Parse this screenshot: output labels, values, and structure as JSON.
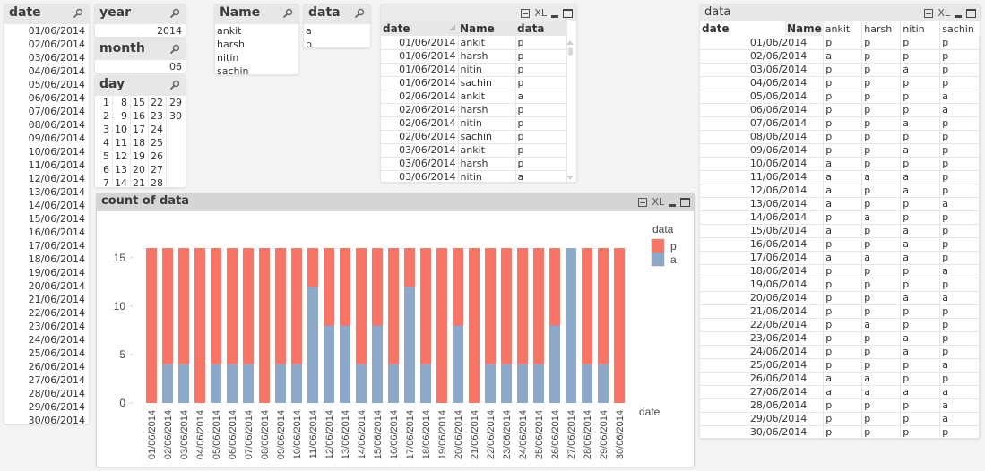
{
  "colors": {
    "p": "#f97565",
    "a": "#8da9c9",
    "header_bg": "#e7e7e7",
    "chart_header_bg": "#d5d5d5"
  },
  "date_listbox": {
    "title": "date",
    "icon": "search-icon",
    "items": [
      "01/06/2014",
      "02/06/2014",
      "03/06/2014",
      "04/06/2014",
      "05/06/2014",
      "06/06/2014",
      "07/06/2014",
      "08/06/2014",
      "09/06/2014",
      "10/06/2014",
      "11/06/2014",
      "12/06/2014",
      "13/06/2014",
      "14/06/2014",
      "15/06/2014",
      "16/06/2014",
      "17/06/2014",
      "18/06/2014",
      "19/06/2014",
      "20/06/2014",
      "21/06/2014",
      "22/06/2014",
      "23/06/2014",
      "24/06/2014",
      "25/06/2014",
      "26/06/2014",
      "27/06/2014",
      "28/06/2014",
      "29/06/2014",
      "30/06/2014"
    ]
  },
  "year_listbox": {
    "title": "year",
    "icon": "search-icon",
    "items": [
      "2014"
    ]
  },
  "month_listbox": {
    "title": "month",
    "icon": "search-icon",
    "items": [
      "06"
    ]
  },
  "day_listbox": {
    "title": "day",
    "icon": "search-icon",
    "columns": [
      [
        "1",
        "2",
        "3",
        "4",
        "5",
        "6",
        "7"
      ],
      [
        "8",
        "9",
        "10",
        "11",
        "12",
        "13",
        "14"
      ],
      [
        "15",
        "16",
        "17",
        "18",
        "19",
        "20",
        "21"
      ],
      [
        "22",
        "23",
        "24",
        "25",
        "26",
        "27",
        "28"
      ],
      [
        "29",
        "30"
      ]
    ]
  },
  "name_listbox": {
    "title": "Name",
    "icon": "search-icon",
    "items": [
      "ankit",
      "harsh",
      "nitin",
      "sachin"
    ]
  },
  "data_listbox": {
    "title": "data",
    "icon": "search-icon",
    "items": [
      "a",
      "p"
    ]
  },
  "table_box": {
    "icons": [
      "print-icon",
      "xl-icon",
      "minimize-icon",
      "maximize-icon"
    ],
    "xl_label": "XL",
    "headers": [
      "date",
      "Name",
      "data"
    ],
    "sort_indicator": "sort-asc-icon",
    "rows": [
      [
        "01/06/2014",
        "ankit",
        "p"
      ],
      [
        "01/06/2014",
        "harsh",
        "p"
      ],
      [
        "01/06/2014",
        "nitin",
        "p"
      ],
      [
        "01/06/2014",
        "sachin",
        "p"
      ],
      [
        "02/06/2014",
        "ankit",
        "a"
      ],
      [
        "02/06/2014",
        "harsh",
        "p"
      ],
      [
        "02/06/2014",
        "nitin",
        "p"
      ],
      [
        "02/06/2014",
        "sachin",
        "p"
      ],
      [
        "03/06/2014",
        "ankit",
        "p"
      ],
      [
        "03/06/2014",
        "harsh",
        "p"
      ],
      [
        "03/06/2014",
        "nitin",
        "a"
      ]
    ]
  },
  "pivot": {
    "title": "data",
    "xl_label": "XL",
    "row_header": "date",
    "col_dim_header": "Name",
    "columns": [
      "ankit",
      "harsh",
      "nitin",
      "sachin"
    ],
    "rows": [
      {
        "date": "01/06/2014",
        "vals": [
          "p",
          "p",
          "p",
          "p"
        ]
      },
      {
        "date": "02/06/2014",
        "vals": [
          "a",
          "p",
          "p",
          "p"
        ]
      },
      {
        "date": "03/06/2014",
        "vals": [
          "p",
          "p",
          "a",
          "p"
        ]
      },
      {
        "date": "04/06/2014",
        "vals": [
          "p",
          "p",
          "p",
          "p"
        ]
      },
      {
        "date": "05/06/2014",
        "vals": [
          "p",
          "p",
          "p",
          "a"
        ]
      },
      {
        "date": "06/06/2014",
        "vals": [
          "p",
          "p",
          "p",
          "a"
        ]
      },
      {
        "date": "07/06/2014",
        "vals": [
          "p",
          "p",
          "a",
          "p"
        ]
      },
      {
        "date": "08/06/2014",
        "vals": [
          "p",
          "p",
          "p",
          "p"
        ]
      },
      {
        "date": "09/06/2014",
        "vals": [
          "p",
          "p",
          "a",
          "p"
        ]
      },
      {
        "date": "10/06/2014",
        "vals": [
          "a",
          "p",
          "p",
          "p"
        ]
      },
      {
        "date": "11/06/2014",
        "vals": [
          "a",
          "a",
          "a",
          "p"
        ]
      },
      {
        "date": "12/06/2014",
        "vals": [
          "a",
          "p",
          "a",
          "p"
        ]
      },
      {
        "date": "13/06/2014",
        "vals": [
          "a",
          "p",
          "p",
          "a"
        ]
      },
      {
        "date": "14/06/2014",
        "vals": [
          "p",
          "a",
          "p",
          "p"
        ]
      },
      {
        "date": "15/06/2014",
        "vals": [
          "a",
          "p",
          "a",
          "p"
        ]
      },
      {
        "date": "16/06/2014",
        "vals": [
          "p",
          "p",
          "a",
          "p"
        ]
      },
      {
        "date": "17/06/2014",
        "vals": [
          "a",
          "a",
          "a",
          "p"
        ]
      },
      {
        "date": "18/06/2014",
        "vals": [
          "p",
          "p",
          "p",
          "a"
        ]
      },
      {
        "date": "19/06/2014",
        "vals": [
          "p",
          "p",
          "p",
          "p"
        ]
      },
      {
        "date": "20/06/2014",
        "vals": [
          "p",
          "p",
          "a",
          "a"
        ]
      },
      {
        "date": "21/06/2014",
        "vals": [
          "p",
          "p",
          "p",
          "p"
        ]
      },
      {
        "date": "22/06/2014",
        "vals": [
          "p",
          "a",
          "p",
          "p"
        ]
      },
      {
        "date": "23/06/2014",
        "vals": [
          "p",
          "p",
          "a",
          "p"
        ]
      },
      {
        "date": "24/06/2014",
        "vals": [
          "p",
          "p",
          "a",
          "p"
        ]
      },
      {
        "date": "25/06/2014",
        "vals": [
          "p",
          "p",
          "p",
          "a"
        ]
      },
      {
        "date": "26/06/2014",
        "vals": [
          "a",
          "a",
          "p",
          "p"
        ]
      },
      {
        "date": "27/06/2014",
        "vals": [
          "a",
          "a",
          "a",
          "a"
        ]
      },
      {
        "date": "28/06/2014",
        "vals": [
          "p",
          "p",
          "p",
          "a"
        ]
      },
      {
        "date": "29/06/2014",
        "vals": [
          "p",
          "p",
          "p",
          "a"
        ]
      },
      {
        "date": "30/06/2014",
        "vals": [
          "p",
          "p",
          "p",
          "p"
        ]
      }
    ]
  },
  "chart_data": {
    "type": "bar",
    "stacked": true,
    "title": "count of data",
    "xlabel": "date",
    "ylabel": "",
    "ylim": [
      0,
      16
    ],
    "yticks": [
      0,
      5,
      10,
      15
    ],
    "grid": false,
    "legend": {
      "title": "data",
      "position": "top-right",
      "entries": [
        "p",
        "a"
      ]
    },
    "categories": [
      "01/06/2014",
      "02/06/2014",
      "03/06/2014",
      "04/06/2014",
      "05/06/2014",
      "06/06/2014",
      "07/06/2014",
      "08/06/2014",
      "09/06/2014",
      "10/06/2014",
      "11/06/2014",
      "12/06/2014",
      "13/06/2014",
      "14/06/2014",
      "15/06/2014",
      "16/06/2014",
      "17/06/2014",
      "18/06/2014",
      "19/06/2014",
      "20/06/2014",
      "21/06/2014",
      "22/06/2014",
      "23/06/2014",
      "24/06/2014",
      "25/06/2014",
      "26/06/2014",
      "27/06/2014",
      "28/06/2014",
      "29/06/2014",
      "30/06/2014"
    ],
    "series": [
      {
        "name": "a",
        "values": [
          0,
          4,
          4,
          0,
          4,
          4,
          4,
          0,
          4,
          4,
          12,
          8,
          8,
          4,
          8,
          4,
          12,
          4,
          0,
          8,
          0,
          4,
          4,
          4,
          4,
          8,
          16,
          4,
          4,
          0
        ]
      },
      {
        "name": "p",
        "values": [
          16,
          12,
          12,
          16,
          12,
          12,
          12,
          16,
          12,
          12,
          4,
          8,
          8,
          12,
          8,
          12,
          4,
          12,
          16,
          8,
          16,
          12,
          12,
          12,
          12,
          8,
          0,
          12,
          12,
          16
        ]
      }
    ],
    "caption_icons": [
      "print-icon",
      "xl-icon",
      "minimize-icon",
      "maximize-icon"
    ],
    "xl_label": "XL"
  }
}
